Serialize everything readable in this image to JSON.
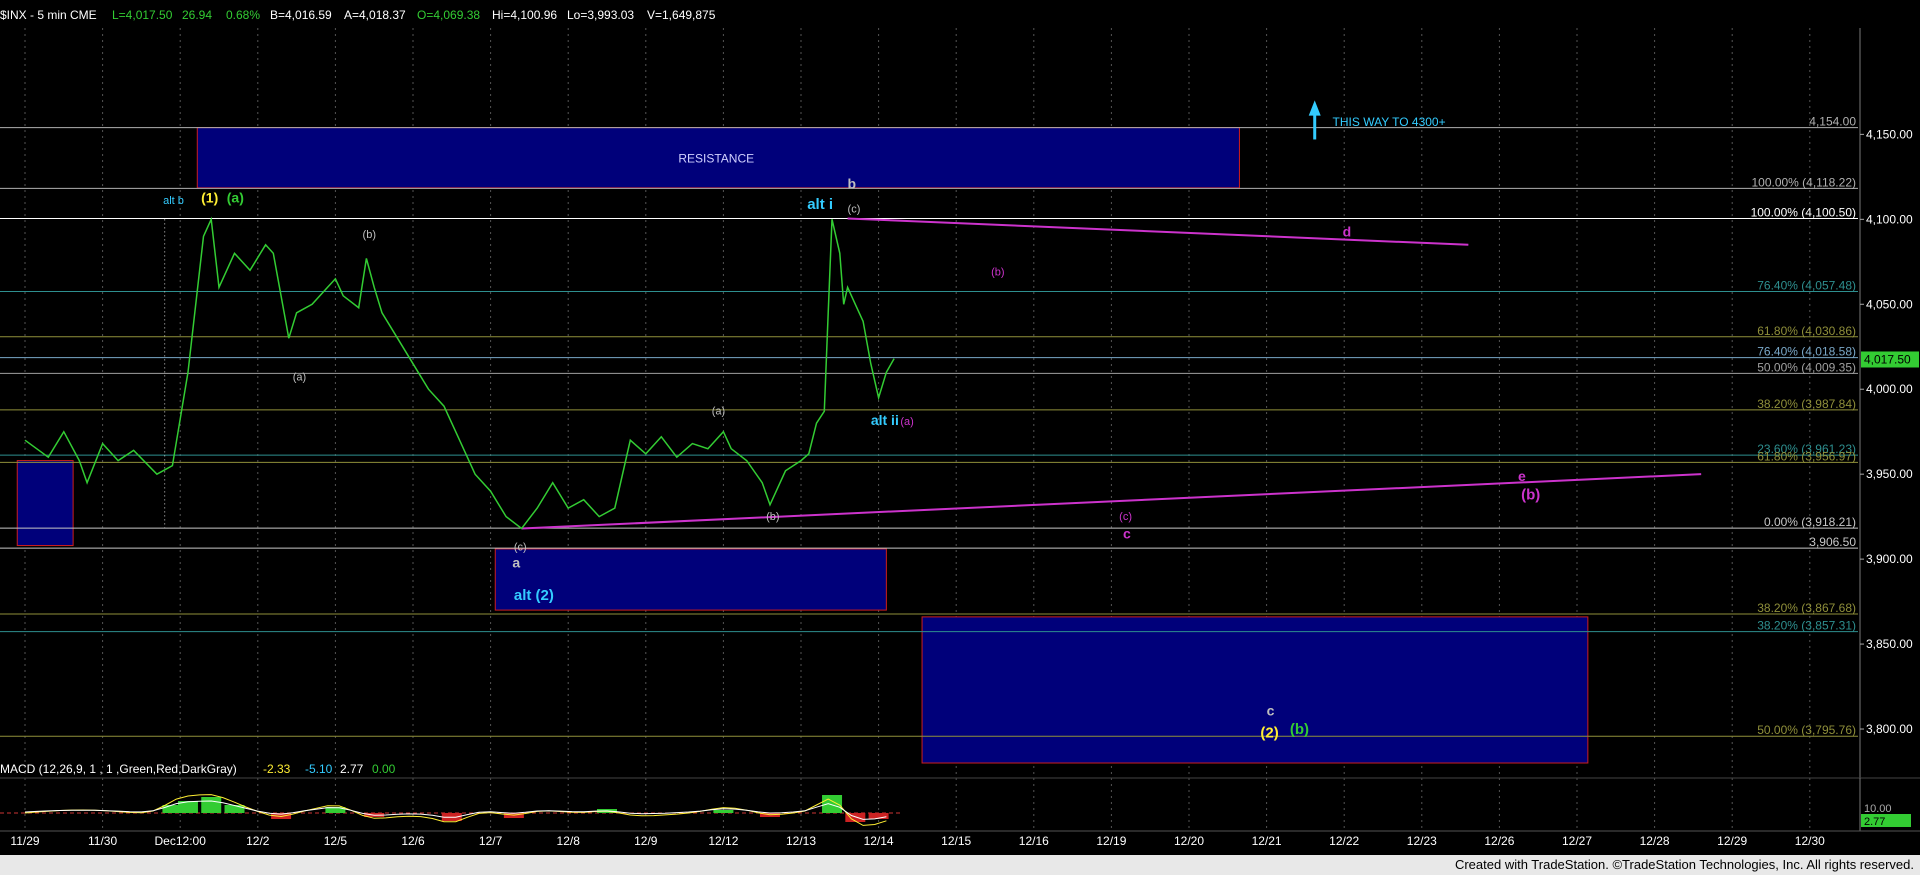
{
  "header": {
    "symbol": "$INX - 5 min  CME",
    "last": "L=4,017.50",
    "change": "26.94",
    "change_pct": "0.68%",
    "bid": "B=4,016.59",
    "ask": "A=4,018.37",
    "open": "O=4,069.38",
    "high": "Hi=4,100.96",
    "low": "Lo=3,993.03",
    "volume": "V=1,649,875"
  },
  "macd_header": {
    "label": "MACD (12,26,9, 1 , 1 ,Green,Red,DarkGray)",
    "v1": "-2.33",
    "v2": "-5.10",
    "v3": "2.77",
    "v4": "0.00"
  },
  "footer": "Created with TradeStation. ©TradeStation Technologies, Inc. All rights reserved.",
  "colors": {
    "price": "#33cc33",
    "fib": "#7a7a3a",
    "box_fill": "#00007a",
    "box_border": "#cc1e1e",
    "magenta": "#cc33cc",
    "cyan": "#33ccff",
    "yellow": "#ffee33",
    "green_label": "#33cc33"
  },
  "chart_data": {
    "type": "line",
    "x_tick_labels": [
      "11/29",
      "11/30",
      "Dec12:00",
      "12/2",
      "12/5",
      "12/6",
      "12/7",
      "12/8",
      "12/9",
      "12/12",
      "12/13",
      "12/14",
      "12/15",
      "12/16",
      "12/19",
      "12/20",
      "12/21",
      "12/22",
      "12/23",
      "12/26",
      "12/27",
      "12/28",
      "12/29",
      "12/30"
    ],
    "y_ticks": [
      3800,
      3850,
      3900,
      3950,
      4000,
      4050,
      4100,
      4150
    ],
    "y_tick_labels": [
      "3,800.00",
      "3,850.00",
      "3,900.00",
      "3,950.00",
      "4,000.00",
      "4,050.00",
      "4,100.00",
      "4,150.00"
    ],
    "ylim": [
      3780,
      4182
    ],
    "last_price_label": "4,017.50",
    "series": [
      {
        "points": [
          [
            0,
            3970
          ],
          [
            0.3,
            3960
          ],
          [
            0.5,
            3975
          ],
          [
            0.7,
            3958
          ],
          [
            0.8,
            3945
          ],
          [
            1,
            3968
          ],
          [
            1.2,
            3958
          ],
          [
            1.4,
            3964
          ],
          [
            1.7,
            3950
          ],
          [
            1.9,
            3955
          ],
          [
            2.1,
            4010
          ],
          [
            2.3,
            4090
          ],
          [
            2.4,
            4100
          ],
          [
            2.5,
            4060
          ],
          [
            2.7,
            4080
          ],
          [
            2.9,
            4070
          ],
          [
            3.1,
            4085
          ],
          [
            3.2,
            4080
          ],
          [
            3.4,
            4030
          ],
          [
            3.5,
            4045
          ],
          [
            3.7,
            4050
          ],
          [
            3.9,
            4060
          ],
          [
            4.0,
            4065
          ],
          [
            4.1,
            4055
          ],
          [
            4.3,
            4048
          ],
          [
            4.4,
            4077
          ],
          [
            4.5,
            4060
          ],
          [
            4.6,
            4045
          ],
          [
            4.8,
            4030
          ],
          [
            5.0,
            4015
          ],
          [
            5.2,
            4000
          ],
          [
            5.4,
            3990
          ],
          [
            5.6,
            3970
          ],
          [
            5.8,
            3950
          ],
          [
            6.0,
            3940
          ],
          [
            6.2,
            3925
          ],
          [
            6.4,
            3918
          ],
          [
            6.6,
            3930
          ],
          [
            6.8,
            3945
          ],
          [
            7.0,
            3930
          ],
          [
            7.2,
            3935
          ],
          [
            7.4,
            3925
          ],
          [
            7.6,
            3930
          ],
          [
            7.8,
            3970
          ],
          [
            8.0,
            3962
          ],
          [
            8.2,
            3972
          ],
          [
            8.4,
            3960
          ],
          [
            8.6,
            3968
          ],
          [
            8.8,
            3965
          ],
          [
            9.0,
            3975
          ],
          [
            9.1,
            3965
          ],
          [
            9.3,
            3958
          ],
          [
            9.5,
            3945
          ],
          [
            9.6,
            3932
          ],
          [
            9.8,
            3952
          ],
          [
            10.0,
            3958
          ],
          [
            10.1,
            3962
          ],
          [
            10.2,
            3980
          ],
          [
            10.3,
            3987
          ],
          [
            10.35,
            4045
          ],
          [
            10.4,
            4100
          ],
          [
            10.5,
            4080
          ],
          [
            10.55,
            4050
          ],
          [
            10.6,
            4060
          ],
          [
            10.7,
            4050
          ],
          [
            10.8,
            4040
          ],
          [
            10.9,
            4015
          ],
          [
            11.0,
            3995
          ],
          [
            11.1,
            4010
          ],
          [
            11.2,
            4018
          ]
        ]
      }
    ],
    "fib_levels": [
      {
        "value": 4154.0,
        "label": "4,154.00",
        "color": "#b0b0b0"
      },
      {
        "value": 4118.22,
        "label": "100.00% (4,118.22)",
        "color": "#b0b0b0"
      },
      {
        "value": 4100.5,
        "label": "100.00% (4,100.50)",
        "color": "#ffffff"
      },
      {
        "value": 4057.48,
        "label": "76.40% (4,057.48)",
        "color": "#2e8f8f"
      },
      {
        "value": 4030.86,
        "label": "61.80% (4,030.86)",
        "color": "#8f8f3a"
      },
      {
        "value": 4018.58,
        "label": "76.40% (4,018.58)",
        "color": "#7aa8c8"
      },
      {
        "value": 4009.35,
        "label": "50.00% (4,009.35)",
        "color": "#a0a0a0"
      },
      {
        "value": 3987.84,
        "label": "38.20% (3,987.84)",
        "color": "#8f8f3a"
      },
      {
        "value": 3961.23,
        "label": "23.60% (3,961.23)",
        "color": "#2e8f8f"
      },
      {
        "value": 3956.97,
        "label": "61.80% (3,956.97)",
        "color": "#8f8f3a"
      },
      {
        "value": 3918.21,
        "label": "0.00% (3,918.21)",
        "color": "#c8c8c8"
      },
      {
        "value": 3906.5,
        "label": "3,906.50",
        "color": "#c8c8c8"
      },
      {
        "value": 3867.68,
        "label": "38.20% (3,867.68)",
        "color": "#8f8f3a"
      },
      {
        "value": 3857.31,
        "label": "38.20% (3,857.31)",
        "color": "#2e8f8f"
      },
      {
        "value": 3795.76,
        "label": "50.00% (3,795.76)",
        "color": "#8f8f3a"
      }
    ],
    "boxes": [
      {
        "x1": 2.22,
        "x2": 15.65,
        "y1": 4154,
        "y2": 4118.5,
        "label": "RESISTANCE"
      },
      {
        "x1": -0.1,
        "x2": 0.62,
        "y1": 3958,
        "y2": 3908,
        "label": ""
      },
      {
        "x1": 6.06,
        "x2": 11.1,
        "y1": 3906,
        "y2": 3870,
        "label": ""
      },
      {
        "x1": 11.56,
        "x2": 20.14,
        "y1": 3866,
        "y2": 3780,
        "label": ""
      }
    ],
    "trend_lines": [
      {
        "x1": 10.6,
        "y1": 4100.5,
        "x2": 18.6,
        "y2": 4085
      },
      {
        "x1": 6.4,
        "y1": 3918,
        "x2": 21.6,
        "y2": 3950
      }
    ],
    "annotations": [
      {
        "text": "alt b",
        "x": 1.78,
        "y": 4109,
        "color": "#33ccff",
        "size": 11
      },
      {
        "text": "(1)",
        "x": 2.27,
        "y": 4110,
        "color": "#ffee33",
        "size": 14
      },
      {
        "text": "(a)",
        "x": 2.6,
        "y": 4110,
        "color": "#33cc33",
        "size": 14
      },
      {
        "text": "(b)",
        "x": 4.35,
        "y": 4089,
        "color": "#bfbfbf",
        "size": 11
      },
      {
        "text": "(a)",
        "x": 3.45,
        "y": 4005,
        "color": "#bfbfbf",
        "size": 11
      },
      {
        "text": "(c)",
        "x": 6.3,
        "y": 3905,
        "color": "#bfbfbf",
        "size": 11
      },
      {
        "text": "a",
        "x": 6.28,
        "y": 3895,
        "color": "#bfbfbf",
        "size": 14
      },
      {
        "text": "alt (2)",
        "x": 6.3,
        "y": 3876,
        "color": "#33ccff",
        "size": 15
      },
      {
        "text": "(a)",
        "x": 8.85,
        "y": 3985,
        "color": "#bfbfbf",
        "size": 11
      },
      {
        "text": "(b)",
        "x": 9.55,
        "y": 3923,
        "color": "#bfbfbf",
        "size": 11
      },
      {
        "text": "b",
        "x": 10.6,
        "y": 4118,
        "color": "#bfbfbf",
        "size": 14
      },
      {
        "text": "alt i",
        "x": 10.08,
        "y": 4106,
        "color": "#33ccff",
        "size": 15
      },
      {
        "text": "(c)",
        "x": 10.6,
        "y": 4104,
        "color": "#bfbfbf",
        "size": 11
      },
      {
        "text": "alt ii",
        "x": 10.9,
        "y": 3979,
        "color": "#33ccff",
        "size": 14
      },
      {
        "text": "(a)",
        "x": 11.28,
        "y": 3979,
        "color": "#cc33cc",
        "size": 11
      },
      {
        "text": "(b)",
        "x": 12.45,
        "y": 4067,
        "color": "#cc33cc",
        "size": 11
      },
      {
        "text": "d",
        "x": 16.98,
        "y": 4090,
        "color": "#cc33cc",
        "size": 14
      },
      {
        "text": "(c)",
        "x": 14.1,
        "y": 3923,
        "color": "#cc33cc",
        "size": 11
      },
      {
        "text": "c",
        "x": 14.15,
        "y": 3912,
        "color": "#cc33cc",
        "size": 14
      },
      {
        "text": "e",
        "x": 19.24,
        "y": 3946,
        "color": "#cc33cc",
        "size": 14
      },
      {
        "text": "(b)",
        "x": 19.28,
        "y": 3935,
        "color": "#cc33cc",
        "size": 15
      },
      {
        "text": "c",
        "x": 16.0,
        "y": 3808,
        "color": "#bfbfbf",
        "size": 14
      },
      {
        "text": "(2)",
        "x": 15.92,
        "y": 3795,
        "color": "#ffee33",
        "size": 15
      },
      {
        "text": "(b)",
        "x": 16.3,
        "y": 3797,
        "color": "#33cc33",
        "size": 15
      },
      {
        "text": "THIS WAY TO 4300+",
        "x": 16.85,
        "y": 4155,
        "color": "#33ccff",
        "size": 12
      }
    ],
    "macd": {
      "ylim": [
        -20,
        25
      ],
      "zero_label": "10.00",
      "last_label": "2.77"
    }
  }
}
